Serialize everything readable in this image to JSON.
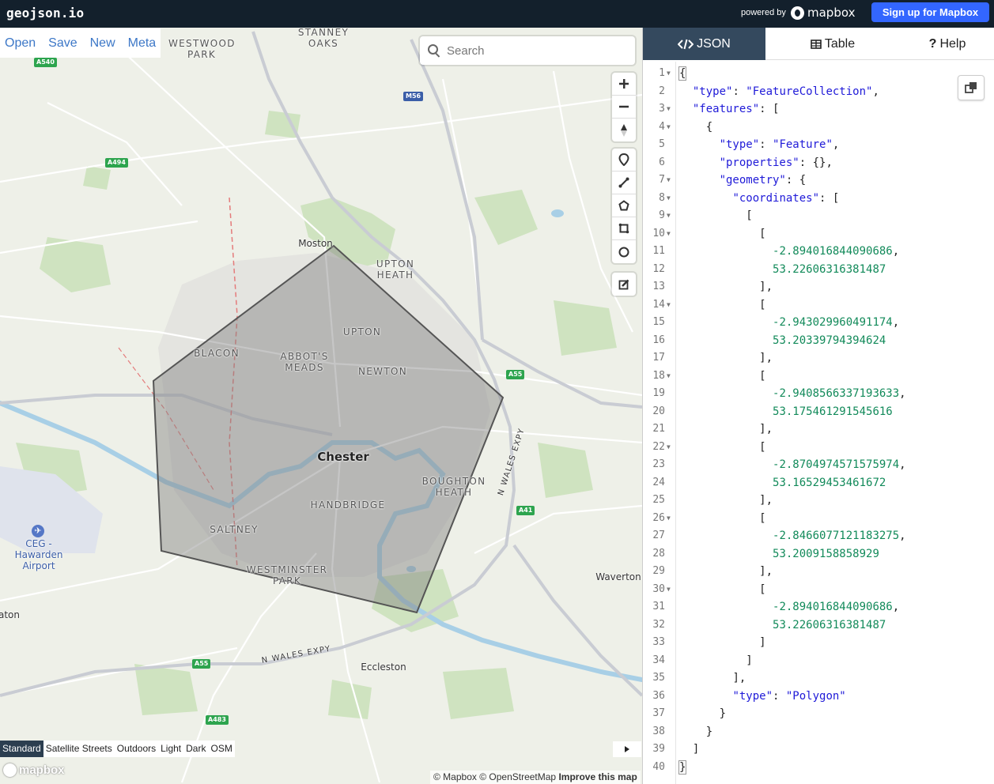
{
  "topbar": {
    "brand": "geojson.io",
    "powered_by": "powered by",
    "mapbox_brand": "mapbox",
    "signup_label": "Sign up for Mapbox"
  },
  "file_menu": {
    "items": [
      "Open",
      "Save",
      "New",
      "Meta"
    ]
  },
  "search": {
    "placeholder": "Search"
  },
  "map": {
    "labels": {
      "westwood": "WESTWOOD\nPARK",
      "stanney": "STANNEY\nOAKS",
      "moston": "Moston",
      "upton_heath": "UPTON\nHEATH",
      "upton": "UPTON",
      "blacon": "BLACON",
      "abbots": "ABBOT'S\nMEADS",
      "newton": "NEWTON",
      "chester": "Chester",
      "boughton": "BOUGHTON\nHEATH",
      "handbridge": "HANDBRIDGE",
      "saltney": "SALTNEY",
      "westminster": "WESTMINSTER\nPARK",
      "ceg": "CEG -\nHawarden\nAirport",
      "waverton": "Waverton",
      "eccleston": "Eccleston",
      "aton": "aton"
    },
    "roads": {
      "a540": "A540",
      "m56": "M56",
      "a494": "A494",
      "a55_east": "A55",
      "a41": "A41",
      "a55_south": "A55",
      "a483": "A483",
      "n_wales_expy": "N WALES EXPY",
      "n_wales_expy_2": "N WALES EXPY"
    },
    "style_switcher": [
      "Standard",
      "Satellite Streets",
      "Outdoors",
      "Light",
      "Dark",
      "OSM"
    ],
    "active_style": "Standard",
    "mapbox_logo": "mapbox",
    "attribution": {
      "mapbox": "© Mapbox",
      "osm": "© OpenStreetMap",
      "improve": "Improve this map"
    },
    "polygon_fill": "#808080",
    "polygon_stroke": "#555555"
  },
  "panel": {
    "tabs": [
      {
        "label": "JSON",
        "active": true
      },
      {
        "label": "Table",
        "active": false
      },
      {
        "label": "Help",
        "active": false
      }
    ]
  },
  "editor": {
    "lines": [
      {
        "n": "1",
        "fold": true,
        "indent": "",
        "parts": [
          [
            "p",
            "{"
          ]
        ]
      },
      {
        "n": "2",
        "fold": false,
        "indent": "  ",
        "parts": [
          [
            "k",
            "\"type\""
          ],
          [
            "p",
            ": "
          ],
          [
            "s",
            "\"FeatureCollection\""
          ],
          [
            "p",
            ","
          ]
        ]
      },
      {
        "n": "3",
        "fold": true,
        "indent": "  ",
        "parts": [
          [
            "k",
            "\"features\""
          ],
          [
            "p",
            ": ["
          ]
        ]
      },
      {
        "n": "4",
        "fold": true,
        "indent": "    ",
        "parts": [
          [
            "p",
            "{"
          ]
        ]
      },
      {
        "n": "5",
        "fold": false,
        "indent": "      ",
        "parts": [
          [
            "k",
            "\"type\""
          ],
          [
            "p",
            ": "
          ],
          [
            "s",
            "\"Feature\""
          ],
          [
            "p",
            ","
          ]
        ]
      },
      {
        "n": "6",
        "fold": false,
        "indent": "      ",
        "parts": [
          [
            "k",
            "\"properties\""
          ],
          [
            "p",
            ": {},"
          ]
        ]
      },
      {
        "n": "7",
        "fold": true,
        "indent": "      ",
        "parts": [
          [
            "k",
            "\"geometry\""
          ],
          [
            "p",
            ": {"
          ]
        ]
      },
      {
        "n": "8",
        "fold": true,
        "indent": "        ",
        "parts": [
          [
            "k",
            "\"coordinates\""
          ],
          [
            "p",
            ": ["
          ]
        ]
      },
      {
        "n": "9",
        "fold": true,
        "indent": "          ",
        "parts": [
          [
            "p",
            "["
          ]
        ]
      },
      {
        "n": "10",
        "fold": true,
        "indent": "            ",
        "parts": [
          [
            "p",
            "["
          ]
        ]
      },
      {
        "n": "11",
        "fold": false,
        "indent": "              ",
        "parts": [
          [
            "n",
            "-2.894016844090686"
          ],
          [
            "p",
            ","
          ]
        ]
      },
      {
        "n": "12",
        "fold": false,
        "indent": "              ",
        "parts": [
          [
            "n",
            "53.22606316381487"
          ]
        ]
      },
      {
        "n": "13",
        "fold": false,
        "indent": "            ",
        "parts": [
          [
            "p",
            "],"
          ]
        ]
      },
      {
        "n": "14",
        "fold": true,
        "indent": "            ",
        "parts": [
          [
            "p",
            "["
          ]
        ]
      },
      {
        "n": "15",
        "fold": false,
        "indent": "              ",
        "parts": [
          [
            "n",
            "-2.943029960491174"
          ],
          [
            "p",
            ","
          ]
        ]
      },
      {
        "n": "16",
        "fold": false,
        "indent": "              ",
        "parts": [
          [
            "n",
            "53.20339794394624"
          ]
        ]
      },
      {
        "n": "17",
        "fold": false,
        "indent": "            ",
        "parts": [
          [
            "p",
            "],"
          ]
        ]
      },
      {
        "n": "18",
        "fold": true,
        "indent": "            ",
        "parts": [
          [
            "p",
            "["
          ]
        ]
      },
      {
        "n": "19",
        "fold": false,
        "indent": "              ",
        "parts": [
          [
            "n",
            "-2.9408566337193633"
          ],
          [
            "p",
            ","
          ]
        ]
      },
      {
        "n": "20",
        "fold": false,
        "indent": "              ",
        "parts": [
          [
            "n",
            "53.175461291545616"
          ]
        ]
      },
      {
        "n": "21",
        "fold": false,
        "indent": "            ",
        "parts": [
          [
            "p",
            "],"
          ]
        ]
      },
      {
        "n": "22",
        "fold": true,
        "indent": "            ",
        "parts": [
          [
            "p",
            "["
          ]
        ]
      },
      {
        "n": "23",
        "fold": false,
        "indent": "              ",
        "parts": [
          [
            "n",
            "-2.8704974571575974"
          ],
          [
            "p",
            ","
          ]
        ]
      },
      {
        "n": "24",
        "fold": false,
        "indent": "              ",
        "parts": [
          [
            "n",
            "53.16529453461672"
          ]
        ]
      },
      {
        "n": "25",
        "fold": false,
        "indent": "            ",
        "parts": [
          [
            "p",
            "],"
          ]
        ]
      },
      {
        "n": "26",
        "fold": true,
        "indent": "            ",
        "parts": [
          [
            "p",
            "["
          ]
        ]
      },
      {
        "n": "27",
        "fold": false,
        "indent": "              ",
        "parts": [
          [
            "n",
            "-2.8466077121183275"
          ],
          [
            "p",
            ","
          ]
        ]
      },
      {
        "n": "28",
        "fold": false,
        "indent": "              ",
        "parts": [
          [
            "n",
            "53.2009158858929"
          ]
        ]
      },
      {
        "n": "29",
        "fold": false,
        "indent": "            ",
        "parts": [
          [
            "p",
            "],"
          ]
        ]
      },
      {
        "n": "30",
        "fold": true,
        "indent": "            ",
        "parts": [
          [
            "p",
            "["
          ]
        ]
      },
      {
        "n": "31",
        "fold": false,
        "indent": "              ",
        "parts": [
          [
            "n",
            "-2.894016844090686"
          ],
          [
            "p",
            ","
          ]
        ]
      },
      {
        "n": "32",
        "fold": false,
        "indent": "              ",
        "parts": [
          [
            "n",
            "53.22606316381487"
          ]
        ]
      },
      {
        "n": "33",
        "fold": false,
        "indent": "            ",
        "parts": [
          [
            "p",
            "]"
          ]
        ]
      },
      {
        "n": "34",
        "fold": false,
        "indent": "          ",
        "parts": [
          [
            "p",
            "]"
          ]
        ]
      },
      {
        "n": "35",
        "fold": false,
        "indent": "        ",
        "parts": [
          [
            "p",
            "],"
          ]
        ]
      },
      {
        "n": "36",
        "fold": false,
        "indent": "        ",
        "parts": [
          [
            "k",
            "\"type\""
          ],
          [
            "p",
            ": "
          ],
          [
            "s",
            "\"Polygon\""
          ]
        ]
      },
      {
        "n": "37",
        "fold": false,
        "indent": "      ",
        "parts": [
          [
            "p",
            "}"
          ]
        ]
      },
      {
        "n": "38",
        "fold": false,
        "indent": "    ",
        "parts": [
          [
            "p",
            "}"
          ]
        ]
      },
      {
        "n": "39",
        "fold": false,
        "indent": "  ",
        "parts": [
          [
            "p",
            "]"
          ]
        ]
      },
      {
        "n": "40",
        "fold": false,
        "indent": "",
        "parts": [
          [
            "p",
            "}"
          ]
        ]
      }
    ]
  }
}
